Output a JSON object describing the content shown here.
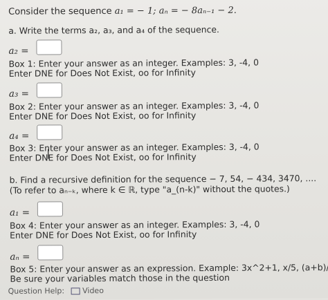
{
  "problem": {
    "intro": "Consider the sequence",
    "sequence_def": "a₁ = − 1; aₙ = − 8aₙ₋₁ − 2."
  },
  "part_a": {
    "prompt": "a. Write the terms a₂, a₃, and a₄ of the sequence."
  },
  "boxes": [
    {
      "var_label": "a₂ =",
      "value": "",
      "hint_line1": "Box 1: Enter your answer as an integer. Examples: 3, -4, 0",
      "hint_line2": "Enter DNE for Does Not Exist, oo for Infinity"
    },
    {
      "var_label": "a₃ =",
      "value": "",
      "hint_line1": "Box 2: Enter your answer as an integer. Examples: 3, -4, 0",
      "hint_line2": "Enter DNE for Does Not Exist, oo for Infinity"
    },
    {
      "var_label": "a₄ =",
      "value": "",
      "hint_line1": "Box 3: Enter your answer as an integer. Examples: 3, -4, 0",
      "hint_line2": "Enter DNE for Does Not Exist, oo for Infinity"
    },
    {
      "var_label": "a₁ =",
      "value": "",
      "hint_line1": "Box 4: Enter your answer as an integer. Examples: 3, -4, 0",
      "hint_line2": "Enter DNE for Does Not Exist, oo for Infinity"
    },
    {
      "var_label": "aₙ =",
      "value": "",
      "hint_line1": "Box 5: Enter your answer as an expression. Example: 3x^2+1, x/5, (a+b)/c",
      "hint_line2": "Be sure your variables match those in the question"
    }
  ],
  "part_b": {
    "prompt": "b. Find a recursive definition for the sequence − 7, 54, − 434, 3470, ....",
    "note": "(To refer to aₙ₋ₖ, where k ∈ ℝ, type \"a_(n-k)\" without the quotes.)"
  },
  "footer": {
    "help_label": "Question Help:",
    "video_label": "Video"
  }
}
